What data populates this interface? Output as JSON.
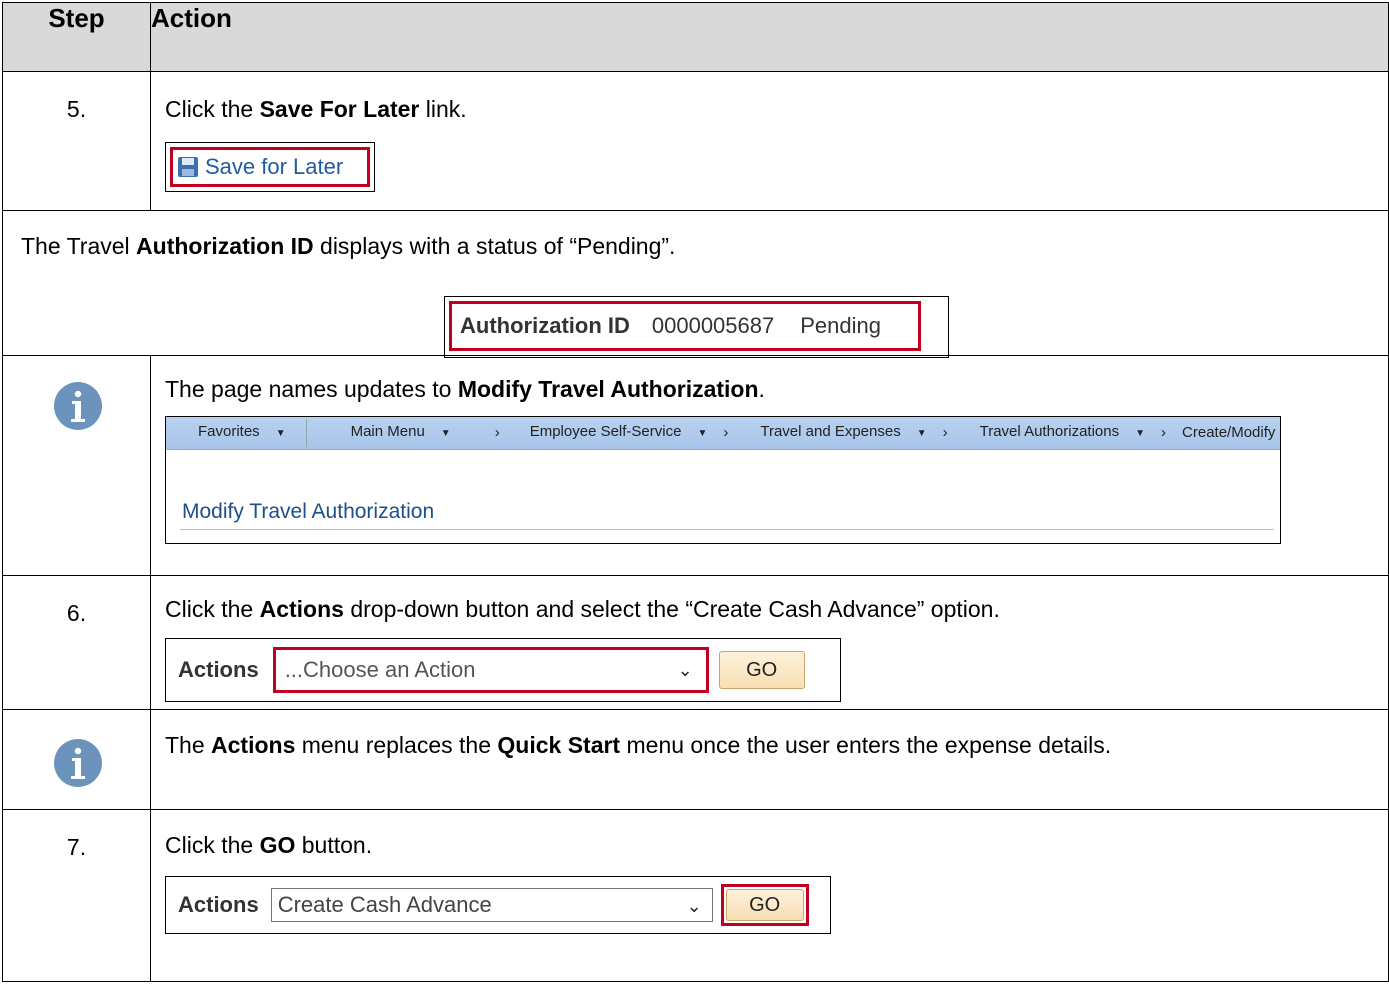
{
  "headers": {
    "step": "Step",
    "action": "Action"
  },
  "row5": {
    "number": "5.",
    "pre": "Click the ",
    "bold": "Save For Later",
    "post": " link.",
    "link_label": "Save for Later",
    "icon": "floppy-disk-icon"
  },
  "auth_row": {
    "pre": "The Travel ",
    "bold": "Authorization ID",
    "post": " displays with a status of “Pending”.",
    "label": "Authorization ID",
    "id": "0000005687",
    "status": "Pending"
  },
  "info1": {
    "pre": "The page names updates to ",
    "bold": "Modify Travel Authorization",
    "post": ".",
    "nav": {
      "favorites": "Favorites",
      "main_menu": "Main Menu",
      "sep": "›",
      "ess": "Employee Self-Service",
      "tae": "Travel and Expenses",
      "ta": "Travel Authorizations",
      "cm": "Create/Modify"
    },
    "page_title": "Modify Travel Authorization"
  },
  "row6": {
    "number": "6.",
    "pre": "Click the ",
    "bold": "Actions",
    "post": " drop-down button and select the “Create Cash Advance” option.",
    "actions_label": "Actions",
    "select_value": "...Choose an Action",
    "go_label": "GO"
  },
  "info2": {
    "pre": "The ",
    "bold1": "Actions",
    "mid": " menu replaces the ",
    "bold2": "Quick Start",
    "post": " menu once the user enters the expense details."
  },
  "row7": {
    "number": "7.",
    "pre": "Click the ",
    "bold": "GO",
    "post": " button.",
    "actions_label": "Actions",
    "select_value": "Create Cash Advance",
    "go_label": "GO"
  },
  "colors": {
    "highlight": "#c00020",
    "header_bg": "#d9d9d9",
    "info_icon": "#6b93bb",
    "link": "#1f5b9f"
  }
}
